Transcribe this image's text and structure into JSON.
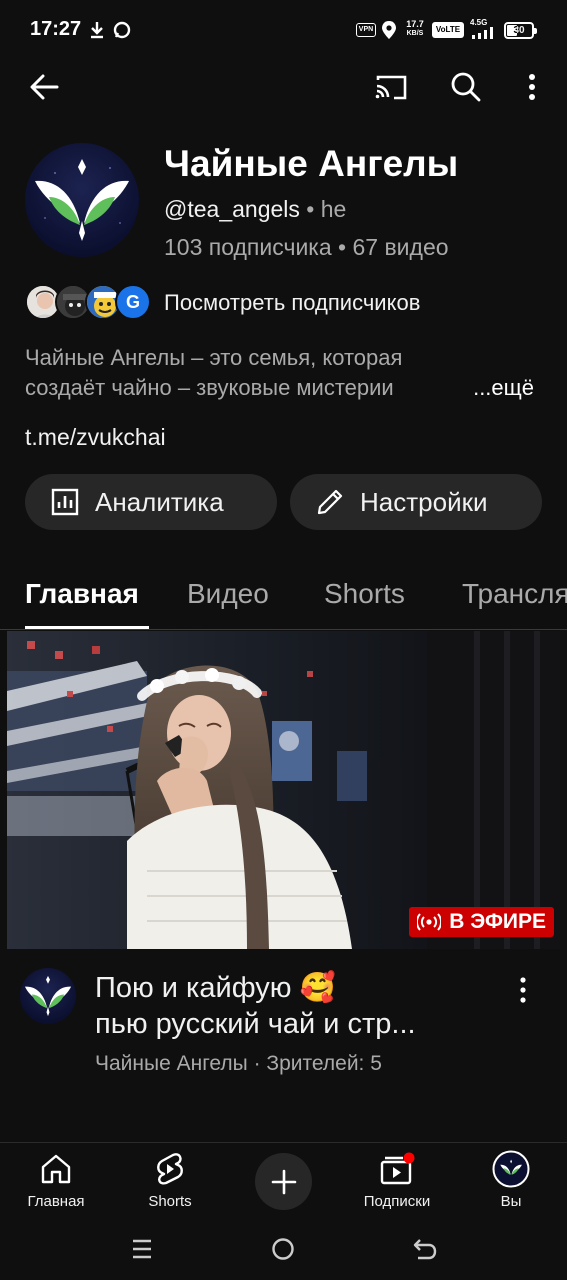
{
  "status_bar": {
    "time": "17:27",
    "net_speed_top": "17.7",
    "net_speed_bottom": "KB/S",
    "vpn": "VPN",
    "volte": "VoLTE",
    "signal": "4.5G",
    "battery": "30"
  },
  "channel": {
    "name": "Чайные Ангелы",
    "handle": "@tea_angels",
    "handle_sep": " • ",
    "handle_more": "he",
    "stats": "103 подписчика • 67 видео",
    "subscribers_link": "Посмотреть подписчиков",
    "subscriber_badge": "G",
    "description_line1": "Чайные Ангелы – это семья, которая",
    "description_line2": "создаёт чайно – звуковые мистерии",
    "description_more": "...ещё",
    "link": "t.me/zvukchai"
  },
  "actions": {
    "analytics_label": "Аналитика",
    "settings_label": "Настройки"
  },
  "tabs": [
    {
      "label": "Главная",
      "active": true
    },
    {
      "label": "Видео",
      "active": false
    },
    {
      "label": "Shorts",
      "active": false
    },
    {
      "label": "Трансляции",
      "active": false
    }
  ],
  "video": {
    "live_badge": "В ЭФИРЕ",
    "title_line1": "Пою и кайфую 🥰",
    "title_line2": "пью русский чай и стр...",
    "channel_name": "Чайные Ангелы",
    "meta_sep": " · ",
    "viewers": "Зрителей: 5"
  },
  "bottom_nav": {
    "home": "Главная",
    "shorts": "Shorts",
    "subscriptions": "Подписки",
    "you": "Вы"
  },
  "colors": {
    "background": "#0f0f0f",
    "pill": "#272727",
    "live_red": "#cc0000",
    "notification_dot": "#ff0000",
    "logo_green": "#5fbf5a"
  }
}
